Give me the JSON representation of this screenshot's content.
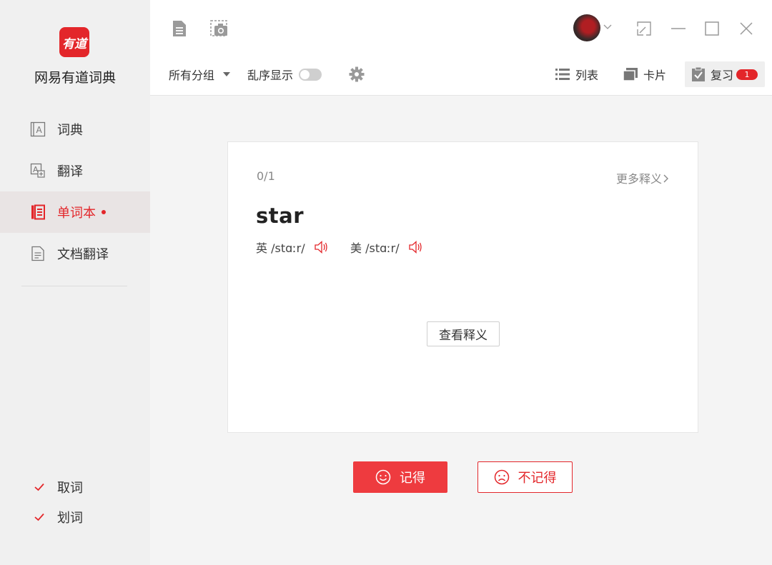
{
  "app": {
    "logo_text": "有道",
    "name": "网易有道词典"
  },
  "sidebar": {
    "items": [
      {
        "label": "词典",
        "icon": "dictionary-icon"
      },
      {
        "label": "翻译",
        "icon": "translate-icon"
      },
      {
        "label": "单词本",
        "icon": "wordbook-icon",
        "active": true,
        "has_dot": true
      },
      {
        "label": "文档翻译",
        "icon": "document-icon"
      }
    ],
    "checks": [
      {
        "label": "取词",
        "checked": true
      },
      {
        "label": "划词",
        "checked": true
      }
    ]
  },
  "toolbar": {
    "group_select": "所有分组",
    "shuffle_label": "乱序显示",
    "shuffle_on": false,
    "view_list": "列表",
    "view_card": "卡片",
    "view_review": "复习",
    "review_badge": "1"
  },
  "card": {
    "progress": "0/1",
    "more_link": "更多释义",
    "word": "star",
    "uk_phonetic": "英 /stɑːr/",
    "us_phonetic": "美 /stɑːr/",
    "view_definition": "查看释义"
  },
  "actions": {
    "remember": "记得",
    "forget": "不记得"
  },
  "colors": {
    "accent": "#e3262a",
    "button_red": "#ee3b3f"
  }
}
